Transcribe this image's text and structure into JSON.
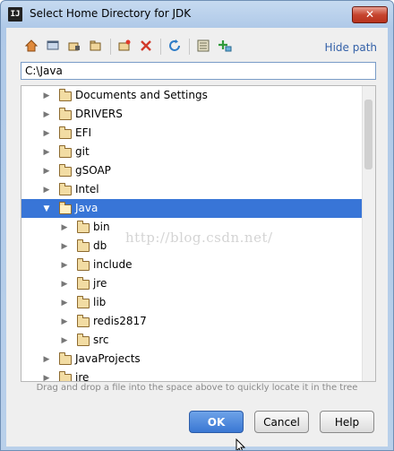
{
  "window": {
    "title": "Select Home Directory for JDK",
    "app_icon": "IJ",
    "close_label": "✕"
  },
  "toolbar": {
    "icons": [
      "home-icon",
      "desktop-icon",
      "project-folder-icon",
      "module-folder-icon",
      "new-folder-icon",
      "delete-icon",
      "refresh-icon",
      "show-hidden-icon",
      "add-icon"
    ],
    "hide_path_label": "Hide path"
  },
  "path": {
    "value": "C:\\Java"
  },
  "tree": {
    "items": [
      {
        "label": "Documents and Settings",
        "level": 0,
        "state": "collapsed"
      },
      {
        "label": "DRIVERS",
        "level": 0,
        "state": "collapsed"
      },
      {
        "label": "EFI",
        "level": 0,
        "state": "collapsed"
      },
      {
        "label": "git",
        "level": 0,
        "state": "collapsed"
      },
      {
        "label": "gSOAP",
        "level": 0,
        "state": "collapsed"
      },
      {
        "label": "Intel",
        "level": 0,
        "state": "collapsed"
      },
      {
        "label": "Java",
        "level": 0,
        "state": "expanded",
        "selected": true
      },
      {
        "label": "bin",
        "level": 1,
        "state": "collapsed"
      },
      {
        "label": "db",
        "level": 1,
        "state": "collapsed"
      },
      {
        "label": "include",
        "level": 1,
        "state": "collapsed"
      },
      {
        "label": "jre",
        "level": 1,
        "state": "collapsed"
      },
      {
        "label": "lib",
        "level": 1,
        "state": "collapsed"
      },
      {
        "label": "redis2817",
        "level": 1,
        "state": "collapsed"
      },
      {
        "label": "src",
        "level": 1,
        "state": "collapsed"
      },
      {
        "label": "JavaProjects",
        "level": 0,
        "state": "collapsed"
      },
      {
        "label": "jre",
        "level": 0,
        "state": "collapsed"
      }
    ],
    "watermark": "http://blog.csdn.net/"
  },
  "hint": "Drag and drop a file into the space above to quickly locate it in the tree",
  "buttons": {
    "ok": "OK",
    "cancel": "Cancel",
    "help": "Help"
  },
  "colors": {
    "selection": "#3875d7",
    "link": "#3461a8",
    "ok_button": "#3a77d3"
  }
}
